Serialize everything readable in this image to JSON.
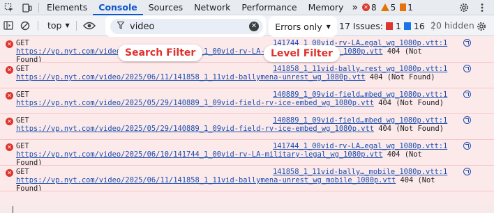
{
  "tabs": {
    "elements": "Elements",
    "console": "Console",
    "sources": "Sources",
    "network": "Network",
    "performance": "Performance",
    "memory": "Memory",
    "more": "»"
  },
  "counts": {
    "errors": "8",
    "warnings": "5",
    "info": "1"
  },
  "toolbar": {
    "context": "top",
    "filter_value": "video",
    "level": "Errors only",
    "issues_label": "17 Issues:",
    "issues_errors": "1",
    "issues_info": "16",
    "hidden": "20 hidden"
  },
  "callouts": {
    "search": "Search Filter",
    "level": "Level Filter"
  },
  "logs": [
    {
      "line1": "GET",
      "url": "https://vp.nyt.com/video/2025/06/10/141744_1_00vid-rv-LA-military-legal_wg_1080p.vtt",
      "tail": " 404 (Not",
      "line3": "Found)",
      "source": "141744_1_00vid-rv-LA…egal_wg_1080p.vtt:1"
    },
    {
      "line1": "GET",
      "url": "https://vp.nyt.com/video/2025/06/11/141858_1_11vid-ballymena-unrest_wg_1080p.vtt",
      "tail": " 404 (Not Found)",
      "line3": "",
      "source": "141858_1_11vid-bally…rest_wg_1080p.vtt:1"
    },
    {
      "line1": "GET",
      "url": "https://vp.nyt.com/video/2025/05/29/140889_1_09vid-field-rv-ice-embed_wg_1080p.vtt",
      "tail": " 404 (Not Found)",
      "line3": "",
      "source": "140889_1_09vid-field…mbed_wg_1080p.vtt:1"
    },
    {
      "line1": "GET",
      "url": "https://vp.nyt.com/video/2025/05/29/140889_1_09vid-field-rv-ice-embed_wg_1080p.vtt",
      "tail": " 404 (Not Found)",
      "line3": "",
      "source": "140889_1_09vid-field…mbed_wg_1080p.vtt:1"
    },
    {
      "line1": "GET",
      "url": "https://vp.nyt.com/video/2025/06/10/141744_1_00vid-rv-LA-military-legal_wg_1080p.vtt",
      "tail": " 404 (Not",
      "line3": "Found)",
      "source": "141744_1_00vid-rv-LA…egal_wg_1080p.vtt:1"
    },
    {
      "line1": "GET",
      "url": "https://vp.nyt.com/video/2025/06/11/141858_1_11vid-ballymena-unrest_wg_mobile_1080p.vtt",
      "tail": " 404 (Not",
      "line3": "Found)",
      "source": "141858_1_11vid-bally…_mobile_1080p.vtt:1"
    }
  ],
  "colors": {
    "accent": "#0b57d0",
    "error": "#dc362e",
    "callout_text": "#e0312c",
    "row_bg": "#fce9ea"
  },
  "icons": [
    "inspect-icon",
    "device-toggle-icon",
    "error-icon",
    "warning-icon",
    "info-icon",
    "settings-icon",
    "more-icon",
    "sidebar-toggle-icon",
    "clear-console-icon",
    "eye-icon",
    "filter-icon",
    "clear-icon",
    "dropdown-icon",
    "reveal-icon"
  ]
}
